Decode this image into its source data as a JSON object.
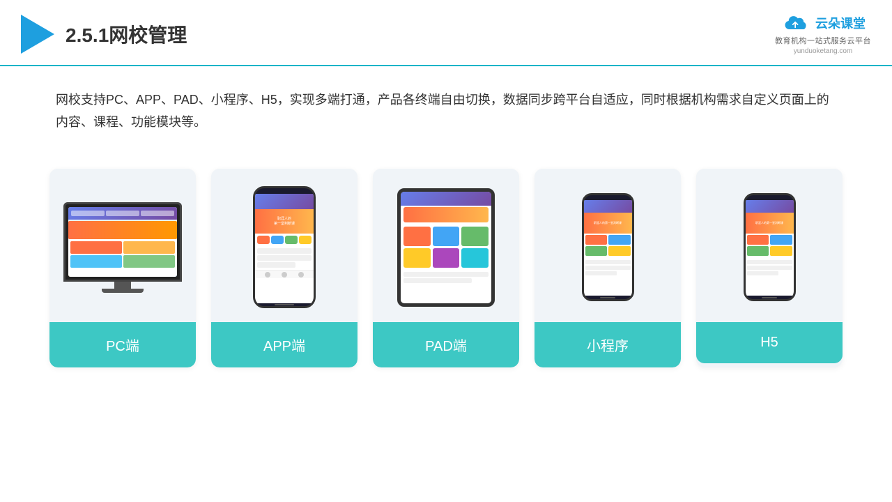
{
  "header": {
    "title": "2.5.1网校管理",
    "brand_name": "云朵课堂",
    "brand_url": "yunduoketang.com",
    "brand_tagline": "教育机构一站式服务云平台"
  },
  "description": {
    "text": "网校支持PC、APP、PAD、小程序、H5，实现多端打通，产品各终端自由切换，数据同步跨平台自适应，同时根据机构需求自定义页面上的内容、课程、功能模块等。"
  },
  "cards": [
    {
      "id": "pc",
      "label": "PC端",
      "type": "pc"
    },
    {
      "id": "app",
      "label": "APP端",
      "type": "phone"
    },
    {
      "id": "pad",
      "label": "PAD端",
      "type": "tablet"
    },
    {
      "id": "miniprogram",
      "label": "小程序",
      "type": "mini-phone"
    },
    {
      "id": "h5",
      "label": "H5",
      "type": "mini-phone"
    }
  ],
  "colors": {
    "accent": "#3dc8c4",
    "header_line": "#00b4c8",
    "title": "#333333",
    "brand_blue": "#1e9fdf"
  }
}
